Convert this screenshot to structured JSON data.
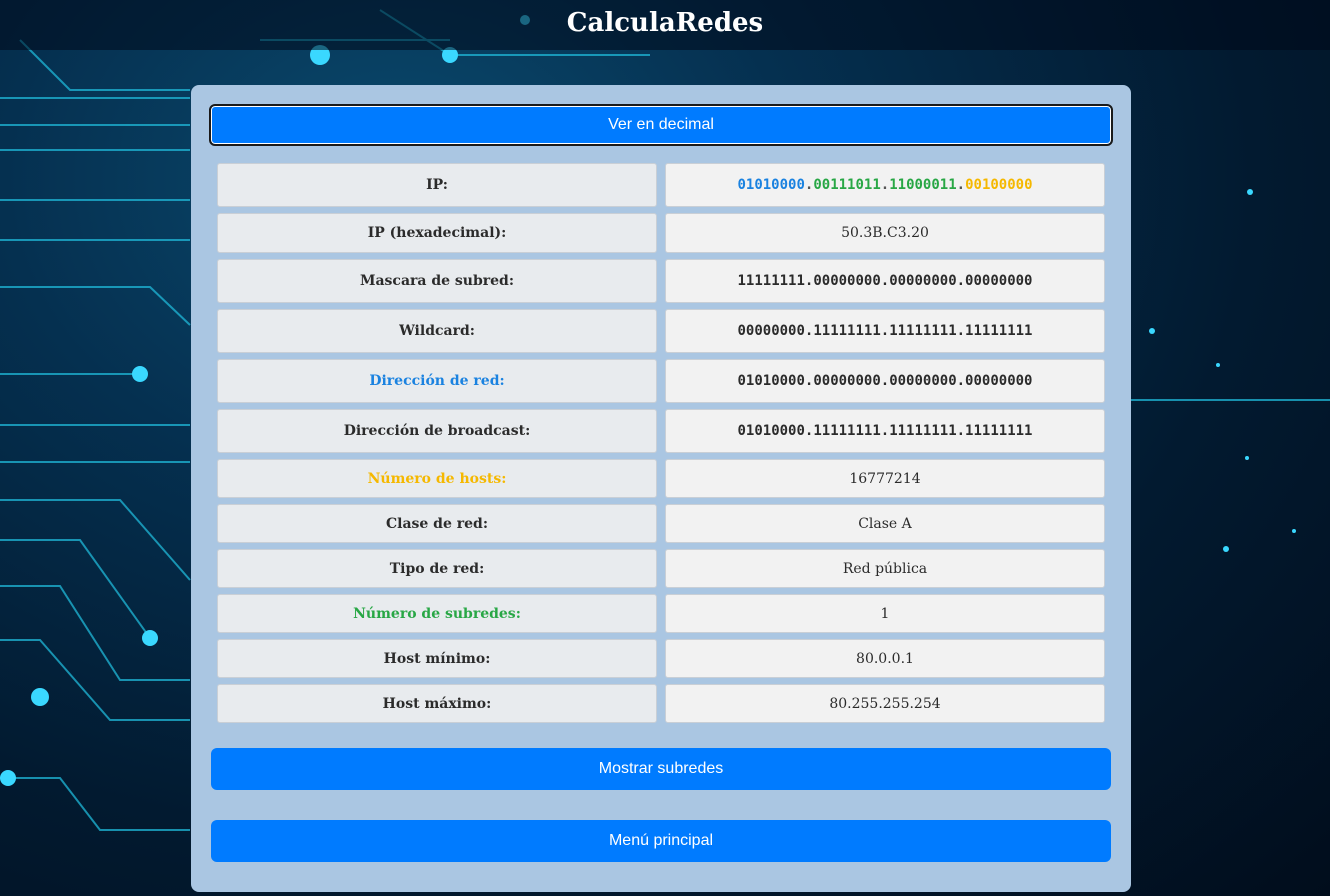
{
  "app": {
    "title": "CalculaRedes"
  },
  "buttons": {
    "toggle": "Ver en decimal",
    "show_subnets": "Mostrar subredes",
    "main_menu": "Menú principal"
  },
  "colors": {
    "button": "#007bff",
    "card": "#aac6e2",
    "network_part": "#1a82e0",
    "subnet_part": "#28a745",
    "host_part": "#f5b800"
  },
  "results": {
    "ip": {
      "label": "IP:",
      "octets": [
        "01010000",
        "00111011",
        "11000011",
        "00100000"
      ],
      "sep": "."
    },
    "ip_hex": {
      "label": "IP (hexadecimal):",
      "value": "50.3B.C3.20"
    },
    "mask": {
      "label": "Mascara de subred:",
      "value": "11111111.00000000.00000000.00000000"
    },
    "wildcard": {
      "label": "Wildcard:",
      "value": "00000000.11111111.11111111.11111111"
    },
    "network": {
      "label": "Dirección de red:",
      "value": "01010000.00000000.00000000.00000000"
    },
    "broadcast": {
      "label": "Dirección de broadcast:",
      "value": "01010000.11111111.11111111.11111111"
    },
    "hosts": {
      "label": "Número de hosts:",
      "value": "16777214"
    },
    "class": {
      "label": "Clase de red:",
      "value": "Clase A"
    },
    "type": {
      "label": "Tipo de red:",
      "value": "Red pública"
    },
    "subnets": {
      "label": "Número de subredes:",
      "value": "1"
    },
    "min_host": {
      "label": "Host mínimo:",
      "value": "80.0.0.1"
    },
    "max_host": {
      "label": "Host máximo:",
      "value": "80.255.255.254"
    }
  }
}
